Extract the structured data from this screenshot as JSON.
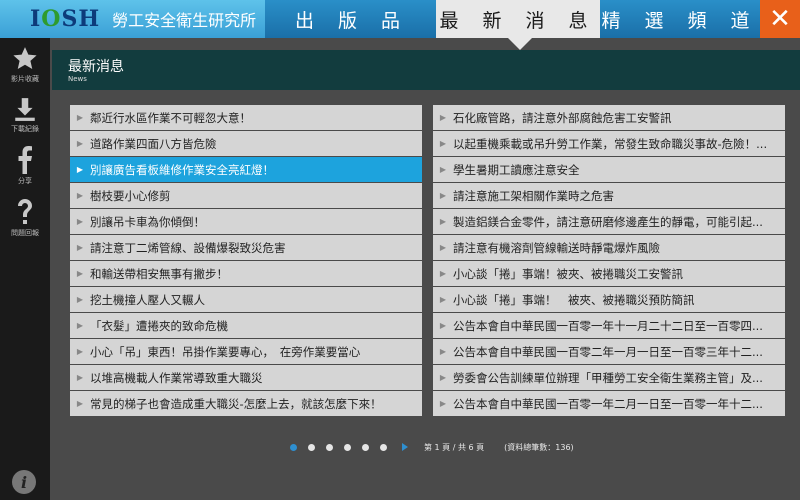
{
  "brand": {
    "logo": "IOSH",
    "name": "勞工安全衛生研究所"
  },
  "nav": {
    "publications": "出 版 品",
    "news": "最 新 消 息",
    "featured": "精 選 頻 道",
    "close": "✕"
  },
  "sidebar": {
    "items": [
      {
        "label": "影片收藏",
        "icon": "star-icon"
      },
      {
        "label": "下載紀錄",
        "icon": "download-icon"
      },
      {
        "label": "分享",
        "icon": "facebook-icon"
      },
      {
        "label": "問題回報",
        "icon": "question-icon"
      }
    ],
    "info": "i"
  },
  "header": {
    "title": "最新消息",
    "subtitle": "News"
  },
  "news_left": [
    "鄰近行水區作業不可輕忽大意！",
    "道路作業四面八方皆危險",
    "別讓廣告看板維修作業安全亮紅燈！",
    "樹枝要小心修剪",
    "別讓吊卡車為你傾倒！",
    "請注意丁二烯管線、設備爆裂致災危害",
    "和輸送帶相安無事有撇步！",
    "挖土機撞人壓人又輾人",
    "「衣髮」遭捲夾的致命危機",
    "小心「吊」東西！吊掛作業要專心，　在旁作業要當心",
    "以堆高機載人作業常導致重大職災",
    "常見的梯子也會造成重大職災-怎麼上去，就該怎麼下來！"
  ],
  "news_right": [
    "石化廠管路，請注意外部腐蝕危害工安警訊",
    "以起重機乘載或吊升勞工作業，常發生致命職災事故-危險！...",
    "學生暑期工讀應注意安全",
    "請注意施工架相關作業時之危害",
    "製造鋁鎂合金零件，請注意研磨修邊產生的靜電，可能引起...",
    "請注意有機溶劑管線輸送時靜電爆炸風險",
    "小心談「捲」事端！被夾、被捲職災工安警訊",
    "小心談「捲」事端！　被夾、被捲職災預防簡訊",
    "公告本會自中華民國一百零一年十一月二十二日至一百零四...",
    "公告本會自中華民國一百零二年一月一日至一百零三年十二...",
    "勞委會公告訓練單位辦理「甲種勞工安全衛生業務主管」及...",
    "公告本會自中華民國一百零一年二月一日至一百零一年十二..."
  ],
  "active_left_index": 2,
  "pager": {
    "dot_count": 6,
    "current_dot": 0,
    "page_info": "第 1 頁 / 共 6 頁",
    "total_info": "(資料總筆數：136)"
  },
  "colors": {
    "active_row": "#1da3dd",
    "close_button": "#e8601a",
    "header_bg": "#123c3e"
  }
}
